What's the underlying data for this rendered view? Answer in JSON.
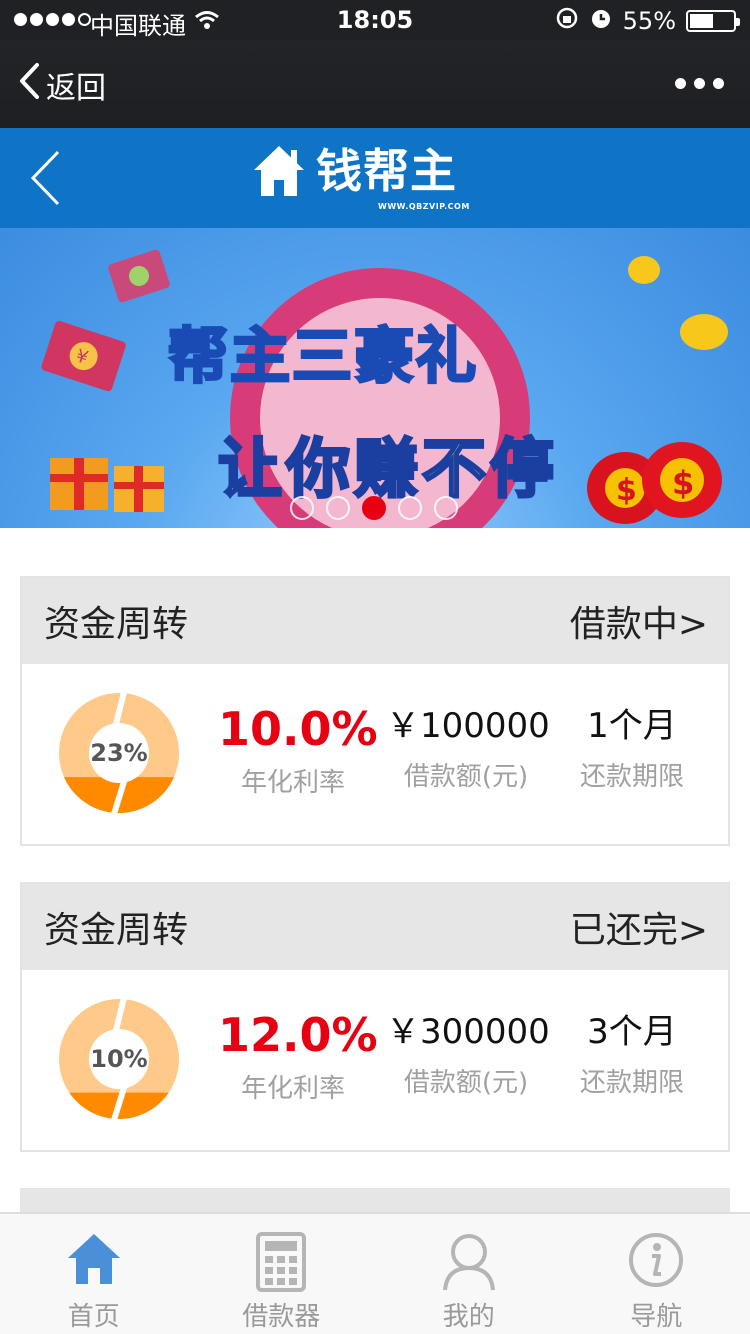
{
  "status_bar": {
    "carrier": "中国联通",
    "time": "18:05",
    "battery": "55%",
    "battery_level": 0.55
  },
  "nav": {
    "back_label": "返回"
  },
  "header": {
    "logo_text": "钱帮主",
    "logo_subtext": "WWW.QBZVIP.COM"
  },
  "banner": {
    "line1": "帮主三豪礼",
    "line2": "让你赚不停",
    "slide_count": 5,
    "active_slide": 3
  },
  "loans": [
    {
      "title": "资金周转",
      "status": "借款中>",
      "progress_label": "23%",
      "progress": 0.23,
      "rate": "10.0%",
      "rate_label": "年化利率",
      "amount": "￥100000",
      "amount_label": "借款额(元)",
      "term": "1个月",
      "term_label": "还款期限"
    },
    {
      "title": "资金周转",
      "status": "已还完>",
      "progress_label": "10%",
      "progress": 0.1,
      "rate": "12.0%",
      "rate_label": "年化利率",
      "amount": "￥300000",
      "amount_label": "借款额(元)",
      "term": "3个月",
      "term_label": "还款期限"
    }
  ],
  "tabs": [
    {
      "label": "首页",
      "icon": "home-icon",
      "active": true
    },
    {
      "label": "借款器",
      "icon": "calculator-icon",
      "active": false
    },
    {
      "label": "我的",
      "icon": "user-icon",
      "active": false
    },
    {
      "label": "导航",
      "icon": "info-icon",
      "active": false
    }
  ],
  "colors": {
    "brand_blue": "#0f74c5",
    "accent_red": "#e60012",
    "ring_orange": "#ff8a00",
    "ring_light": "#ffc98a",
    "tab_active": "#4a90d9"
  }
}
